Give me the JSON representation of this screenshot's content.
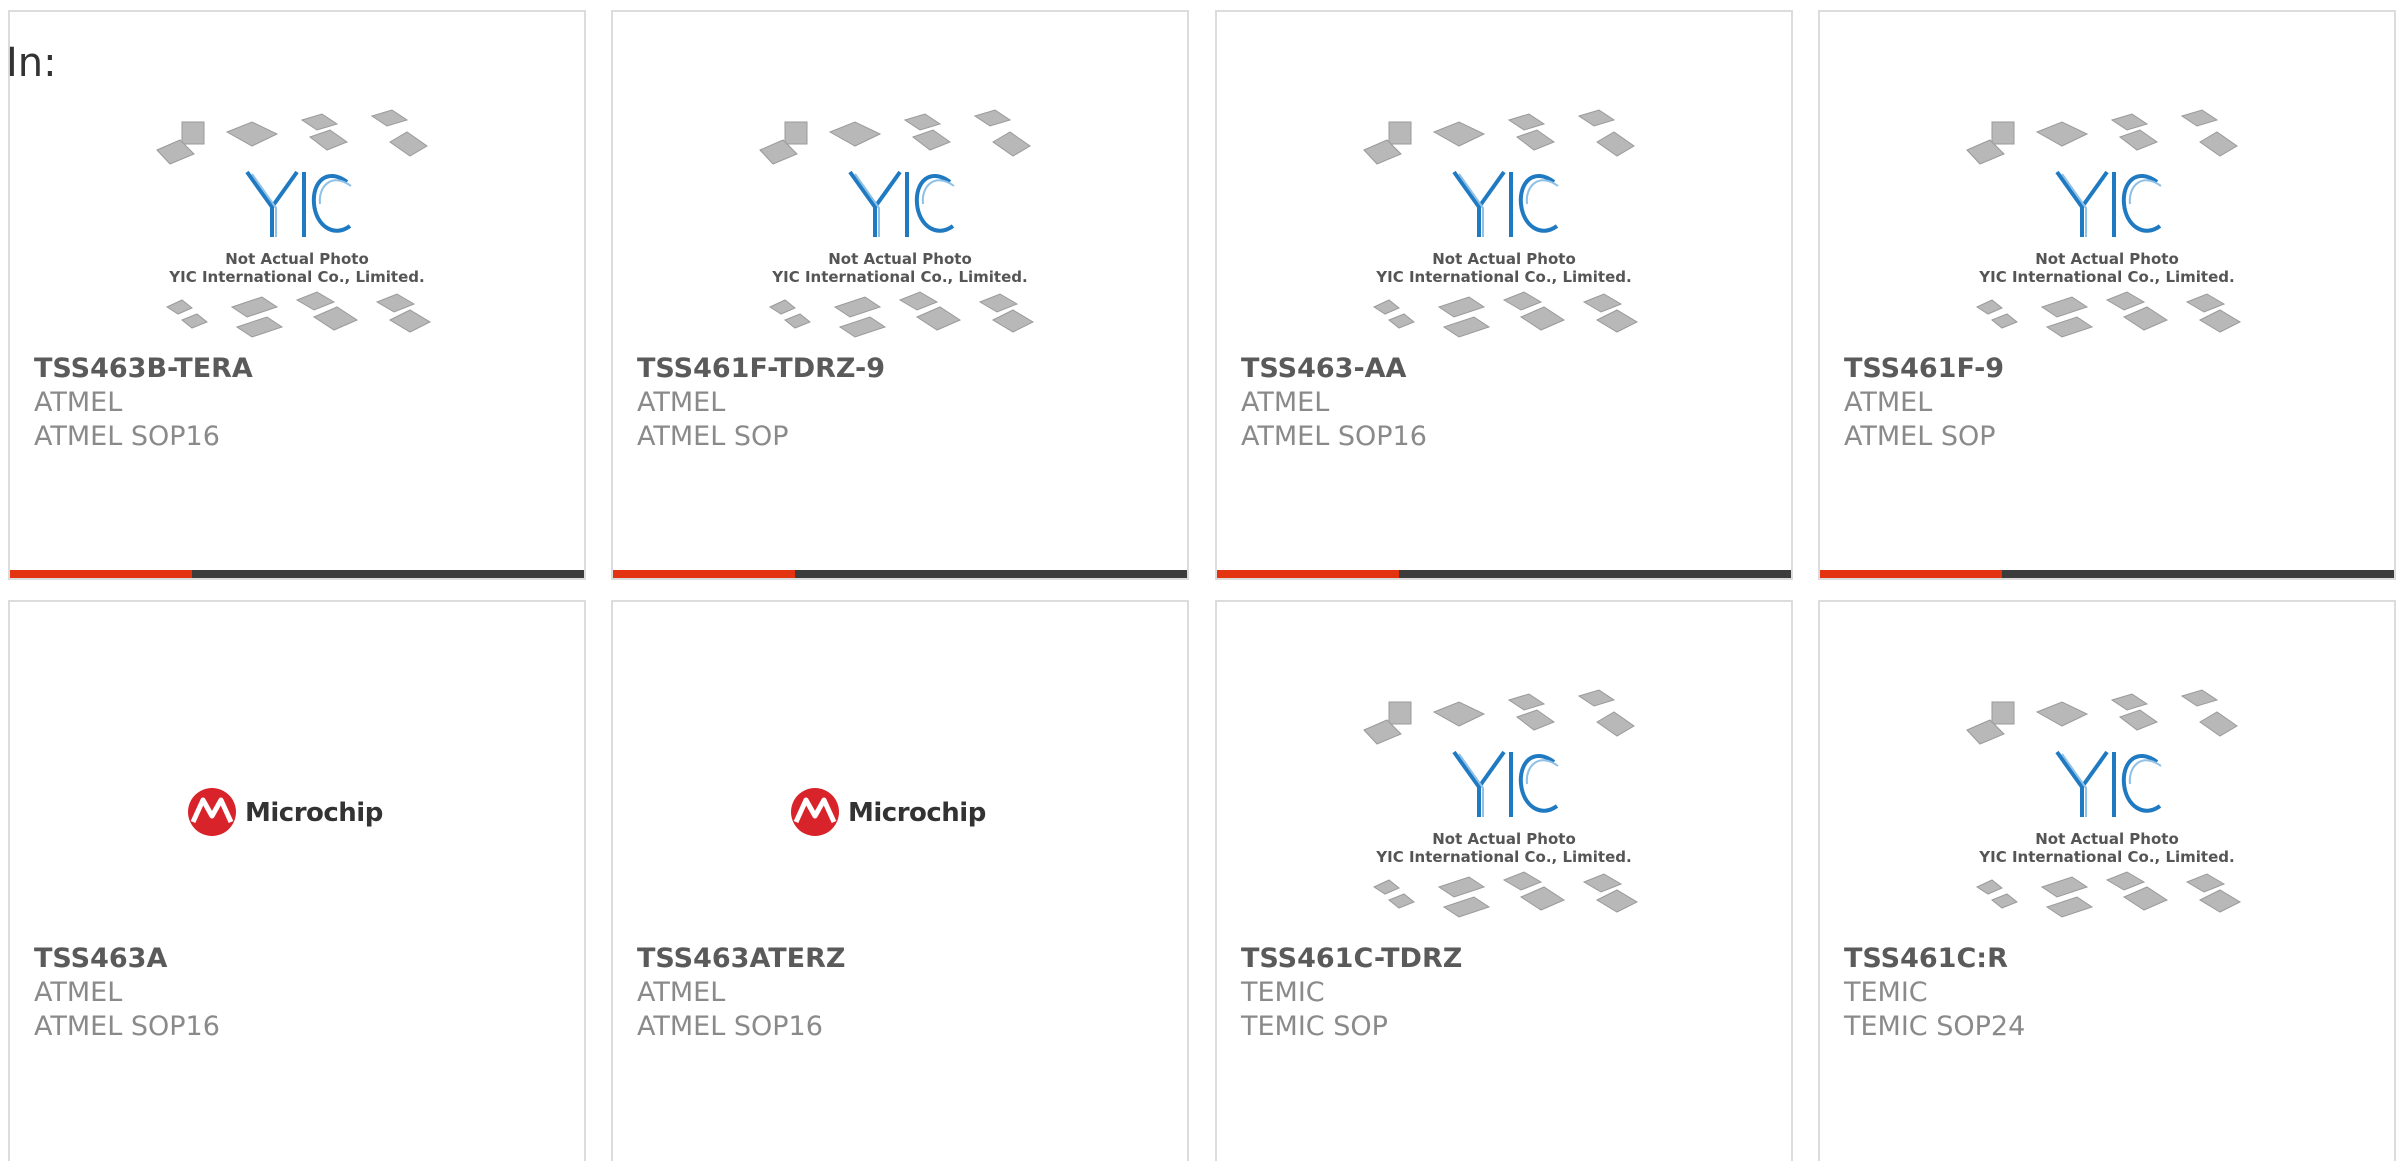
{
  "filter": {
    "label": "In:"
  },
  "placeholder_photo": {
    "line1": "Not Actual Photo",
    "line2": "YIC International Co., Limited.",
    "logo_text": "YIC"
  },
  "brand_logo": {
    "text": "Microchip"
  },
  "colors": {
    "accent": "#e33311",
    "bar": "#3c3c3c",
    "card_border": "#dcdcdc",
    "yic_blue": "#1f7ac2",
    "microchip_red": "#d8232a"
  },
  "products": [
    {
      "part": "TSS463B-TERA",
      "manufacturer": "ATMEL",
      "package": "ATMEL SOP16",
      "image": "yic-placeholder"
    },
    {
      "part": "TSS461F-TDRZ-9",
      "manufacturer": "ATMEL",
      "package": "ATMEL SOP",
      "image": "yic-placeholder"
    },
    {
      "part": "TSS463-AA",
      "manufacturer": "ATMEL",
      "package": "ATMEL SOP16",
      "image": "yic-placeholder"
    },
    {
      "part": "TSS461F-9",
      "manufacturer": "ATMEL",
      "package": "ATMEL SOP",
      "image": "yic-placeholder"
    },
    {
      "part": "TSS463A",
      "manufacturer": "ATMEL",
      "package": "ATMEL SOP16",
      "image": "microchip-logo"
    },
    {
      "part": "TSS463ATERZ",
      "manufacturer": "ATMEL",
      "package": "ATMEL SOP16",
      "image": "microchip-logo"
    },
    {
      "part": "TSS461C-TDRZ",
      "manufacturer": "TEMIC",
      "package": "TEMIC SOP",
      "image": "yic-placeholder"
    },
    {
      "part": "TSS461C:R",
      "manufacturer": "TEMIC",
      "package": "TEMIC SOP24",
      "image": "yic-placeholder"
    }
  ]
}
